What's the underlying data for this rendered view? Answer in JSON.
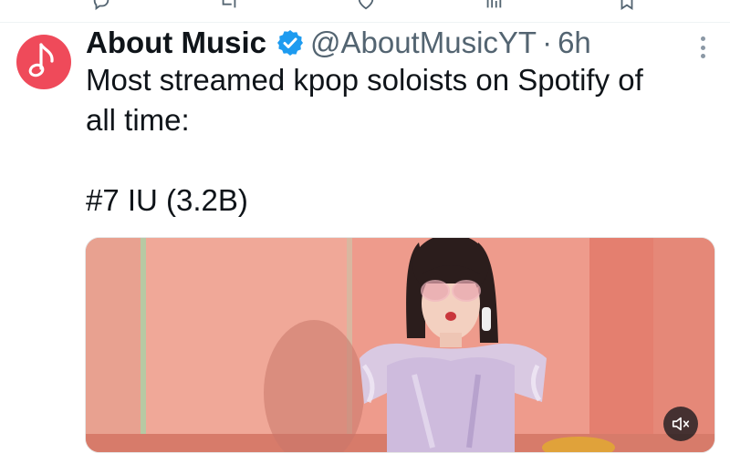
{
  "prev_post_actions": [
    "reply-icon",
    "repost-icon",
    "like-icon",
    "views-icon",
    "bookmark-icon"
  ],
  "post": {
    "author": {
      "display_name": "About Music",
      "handle": "@AboutMusicYT",
      "separator": "·",
      "time": "6h",
      "verified": true,
      "avatar_icon": "music-note-icon",
      "avatar_color": "#ef4a5a"
    },
    "text_line1": "Most streamed kpop soloists on Spotify of",
    "text_line2": "all time:",
    "text_line3": "#7 IU (3.2B)",
    "media": {
      "type": "video",
      "mute_icon": "volume-muted-icon"
    },
    "more_icon": "more-vertical-icon"
  },
  "colors": {
    "verified": "#1d9bf0",
    "secondary_text": "#536471"
  }
}
